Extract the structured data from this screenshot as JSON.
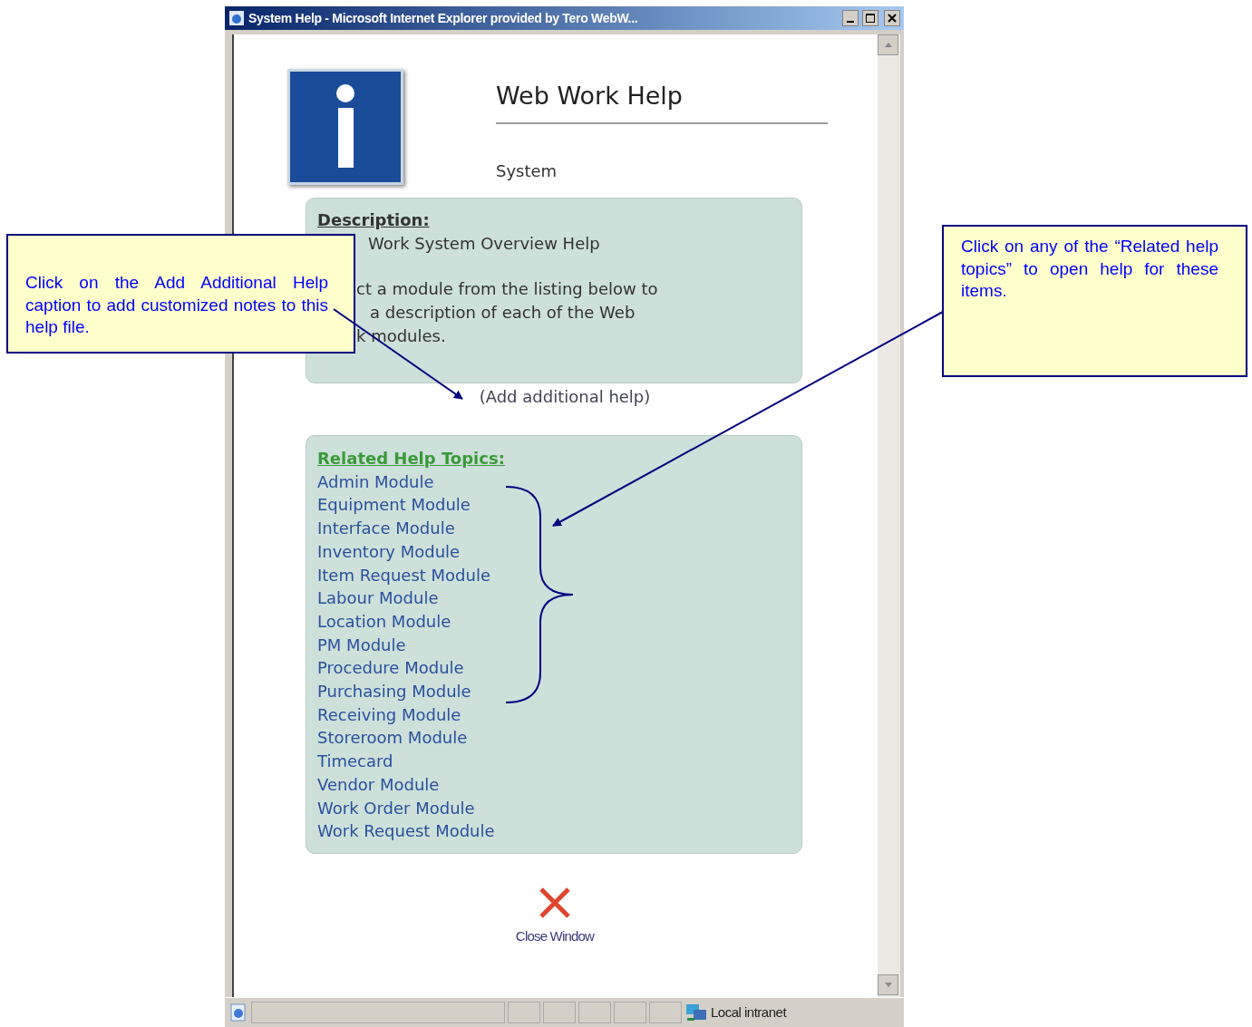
{
  "window": {
    "title": "System Help - Microsoft Internet Explorer provided by Tero WebW..."
  },
  "header": {
    "title": "Web Work Help",
    "subtitle": "System"
  },
  "description": {
    "heading": "Description:",
    "lines": [
      "Work System Overview Help",
      "ct a module from the listing below to",
      "a description of each of the Web",
      "k modules."
    ]
  },
  "add_help_link": "(Add additional help)",
  "related": {
    "heading": "Related Help Topics:",
    "items": [
      "Admin Module",
      "Equipment Module",
      "Interface Module",
      "Inventory Module",
      "Item Request Module",
      "Labour Module",
      "Location Module",
      "PM Module",
      "Procedure Module",
      "Purchasing Module",
      "Receiving Module",
      "Storeroom Module",
      "Timecard",
      "Vendor Module",
      "Work Order Module",
      "Work Request Module"
    ]
  },
  "close": {
    "label": "Close Window"
  },
  "status_bar": {
    "zone": "Local intranet"
  },
  "callouts": [
    {
      "text": "Click on the Add Additional Help caption to add customized notes to this help file."
    },
    {
      "text": "Click on any of the “Related help topics” to open help for these items."
    }
  ]
}
